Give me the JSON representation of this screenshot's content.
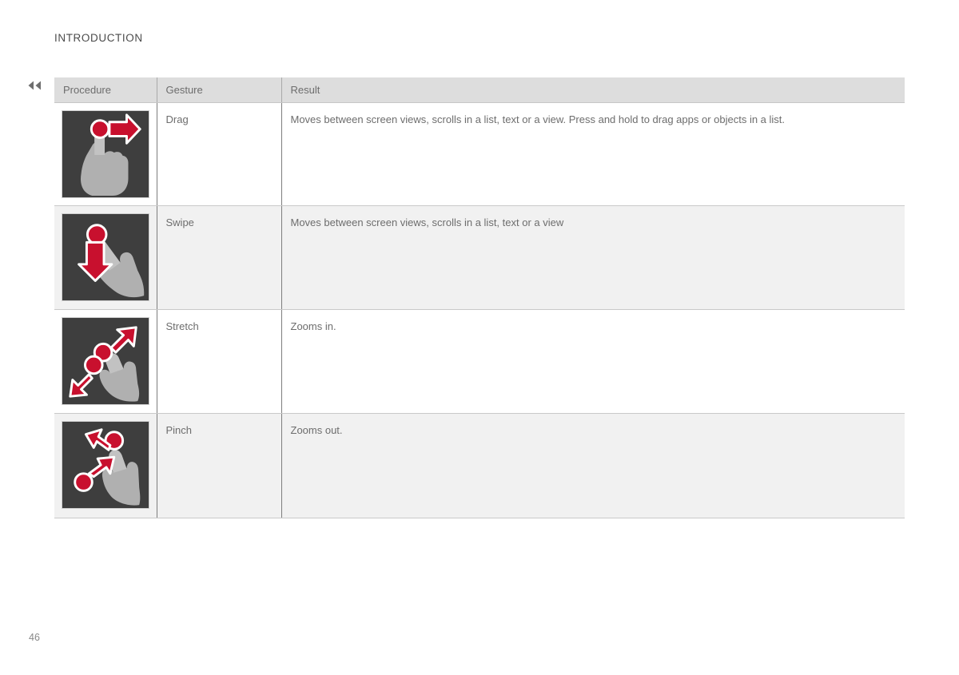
{
  "page": {
    "section_title": "INTRODUCTION",
    "page_number": "46",
    "back_marker": "double-left-arrow"
  },
  "colors": {
    "accent_red": "#c8102e",
    "tile_background": "#3e3e3e",
    "hand_gray": "#b0b0b0",
    "header_background": "#dddddd",
    "row_band_gray": "#f1f1f1",
    "text_gray": "#6d6d6d"
  },
  "table": {
    "columns": [
      {
        "key": "procedure",
        "label": "Procedure"
      },
      {
        "key": "gesture",
        "label": "Gesture"
      },
      {
        "key": "result",
        "label": "Result"
      }
    ],
    "rows": [
      {
        "icon": "drag-gesture-icon",
        "gesture": "Drag",
        "result": "Moves between screen views, scrolls in a list, text or a view. Press and hold to drag apps or objects in a list."
      },
      {
        "icon": "swipe-gesture-icon",
        "gesture": "Swipe",
        "result": "Moves between screen views, scrolls in a list, text or a view"
      },
      {
        "icon": "stretch-gesture-icon",
        "gesture": "Stretch",
        "result": "Zooms in."
      },
      {
        "icon": "pinch-gesture-icon",
        "gesture": "Pinch",
        "result": "Zooms out."
      }
    ]
  }
}
